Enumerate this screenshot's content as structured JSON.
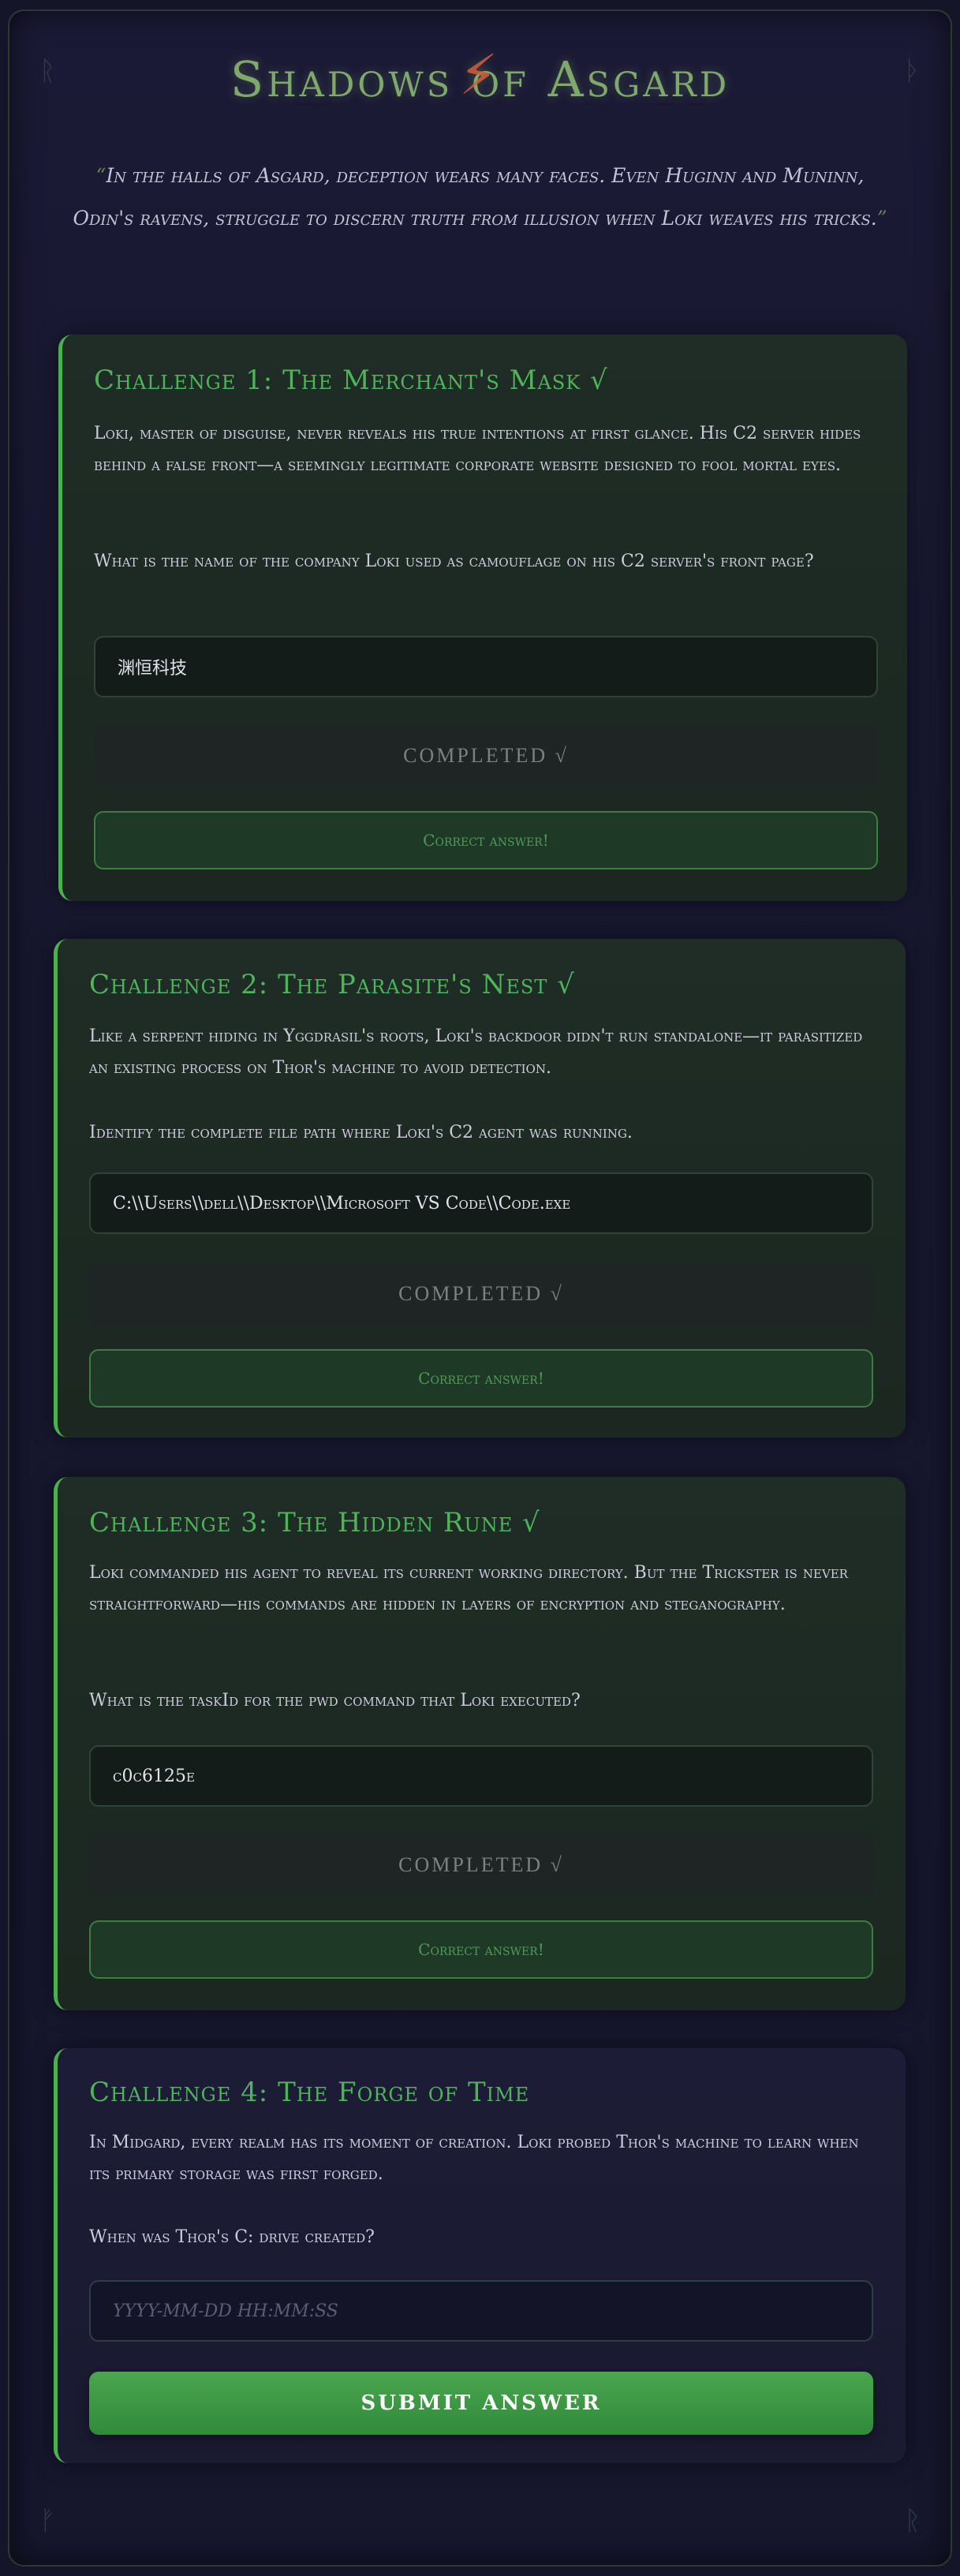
{
  "page": {
    "title": "Shadows of Asgard",
    "quote_open": "“",
    "quote_text": "In the halls of Asgard, deception wears many faces. Even Huginn and Muninn, Odin's ravens, struggle to discern truth from illusion when Loki weaves his tricks.",
    "quote_close": "”",
    "runes": [
      "ᚱ",
      "ᚦ",
      "ᚠ",
      "ᚱ"
    ]
  },
  "colors": {
    "accent": "#4caf50",
    "completed_bg": "#1f2524",
    "correct_border": "#3b7e42"
  },
  "challenges": [
    {
      "title": "Challenge 1: The Merchant's Mask √",
      "description": "Loki, master of disguise, never reveals his true intentions at first glance. His C2 server hides behind a false front—a seemingly legitimate corporate website designed to fool mortal eyes.",
      "question": "What is the name of the company Loki used as camouflage on his C2 server's front page?",
      "answer": "渊恒科技",
      "button": "COMPLETED √",
      "feedback": "Correct answer!",
      "status": "completed"
    },
    {
      "title": "Challenge 2: The Parasite's Nest √",
      "description": "Like a serpent hiding in Yggdrasil's roots, Loki's backdoor didn't run standalone—it parasitized an existing process on Thor's machine to avoid detection.",
      "question": "Identify the complete file path where Loki's C2 agent was running.",
      "answer": "C:\\\\Users\\\\dell\\\\Desktop\\\\Microsoft VS Code\\\\Code.exe",
      "button": "COMPLETED √",
      "feedback": "Correct answer!",
      "status": "completed"
    },
    {
      "title": "Challenge 3: The Hidden Rune √",
      "description": "Loki commanded his agent to reveal its current working directory. But the Trickster is never straightforward—his commands are hidden in layers of encryption and steganography.",
      "question": "What is the taskId for the pwd command that Loki executed?",
      "answer": "c0c6125e",
      "button": "COMPLETED √",
      "feedback": "Correct answer!",
      "status": "completed"
    },
    {
      "title": "Challenge 4: The Forge of Time",
      "description": "In Midgard, every realm has its moment of creation. Loki probed Thor's machine to learn when its primary storage was first forged.",
      "question": "When was Thor's C: drive created?",
      "placeholder": "YYYY-MM-DD HH:MM:SS",
      "button": "SUBMIT ANSWER",
      "status": "active"
    }
  ]
}
